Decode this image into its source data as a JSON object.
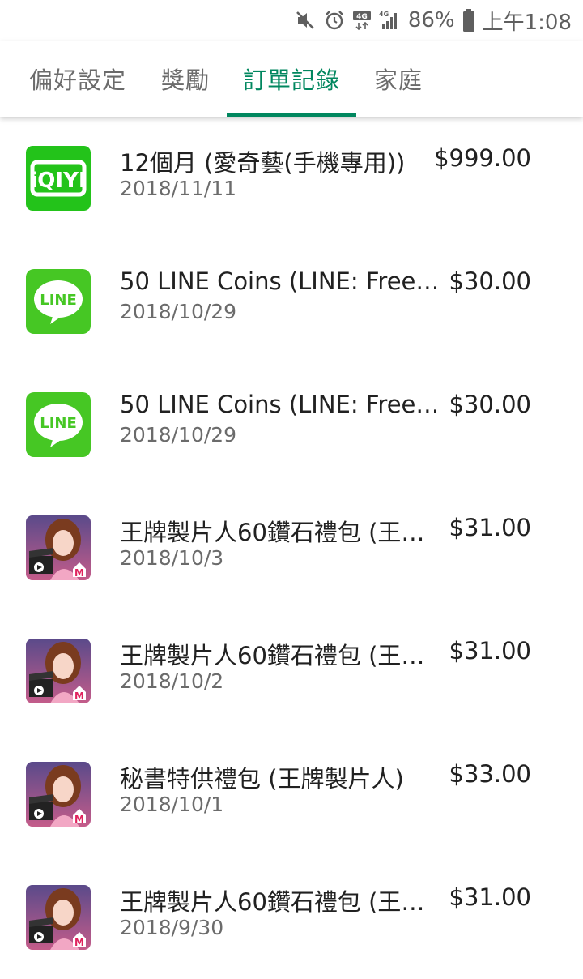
{
  "status_bar": {
    "battery": "86%",
    "time": "上午1:08",
    "network": "4G",
    "icons": [
      "mute-icon",
      "alarm-icon",
      "signal-icon",
      "battery-icon"
    ]
  },
  "tabs": [
    {
      "label": "偏好設定",
      "active": false
    },
    {
      "label": "獎勵",
      "active": false
    },
    {
      "label": "訂單記錄",
      "active": true
    },
    {
      "label": "家庭",
      "active": false
    }
  ],
  "colors": {
    "accent": "#01875f",
    "iqiyi": "#23c31a",
    "line": "#46c724"
  },
  "orders": [
    {
      "title": "12個月 (愛奇藝(手機專用))",
      "date": "2018/11/11",
      "price": "$999.00",
      "icon": "iqiyi-icon",
      "icon_text": "iQIYI"
    },
    {
      "title": "50 LINE Coins (LINE: Free…",
      "date": "2018/10/29",
      "price": "$30.00",
      "icon": "line-icon",
      "icon_text": "LINE"
    },
    {
      "title": "50 LINE Coins (LINE: Free…",
      "date": "2018/10/29",
      "price": "$30.00",
      "icon": "line-icon",
      "icon_text": "LINE"
    },
    {
      "title": "王牌製片人60鑽石禮包 (王…",
      "date": "2018/10/3",
      "price": "$31.00",
      "icon": "game-producer-icon"
    },
    {
      "title": "王牌製片人60鑽石禮包 (王…",
      "date": "2018/10/2",
      "price": "$31.00",
      "icon": "game-producer-icon"
    },
    {
      "title": "秘書特供禮包 (王牌製片人)",
      "date": "2018/10/1",
      "price": "$33.00",
      "icon": "game-producer-icon"
    },
    {
      "title": "王牌製片人60鑽石禮包 (王…",
      "date": "2018/9/30",
      "price": "$31.00",
      "icon": "game-producer-icon"
    }
  ]
}
